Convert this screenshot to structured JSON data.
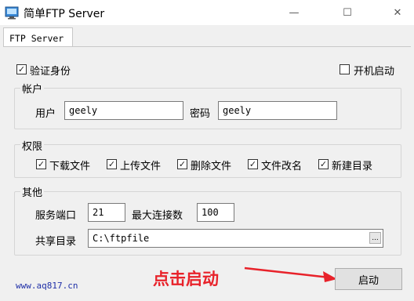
{
  "window": {
    "title": "简单FTP Server",
    "minimize_glyph": "—",
    "maximize_glyph": "☐",
    "close_glyph": "✕",
    "icon": "app-icon"
  },
  "tabs": [
    {
      "label": "FTP Server",
      "selected": true
    }
  ],
  "auth": {
    "label": "验证身份",
    "checked": true,
    "check_glyph": "✓"
  },
  "autostart": {
    "label": "开机启动",
    "checked": false
  },
  "account": {
    "group_title": "帐户",
    "user_label": "用户",
    "user_value": "geely",
    "password_label": "密码",
    "password_value": "geely"
  },
  "permissions": {
    "group_title": "权限",
    "items": [
      {
        "label": "下载文件",
        "checked": true
      },
      {
        "label": "上传文件",
        "checked": true
      },
      {
        "label": "删除文件",
        "checked": true
      },
      {
        "label": "文件改名",
        "checked": true
      },
      {
        "label": "新建目录",
        "checked": true
      }
    ]
  },
  "other": {
    "group_title": "其他",
    "port_label": "服务端口",
    "port_value": "21",
    "maxconn_label": "最大连接数",
    "maxconn_value": "100",
    "share_label": "共享目录",
    "share_value": "C:\\ftpfile",
    "browse_label": "..."
  },
  "footer": {
    "site": "www.aq817.cn",
    "annotation": "点击启动",
    "annotation_color": "#e8222a",
    "start_label": "启动"
  }
}
